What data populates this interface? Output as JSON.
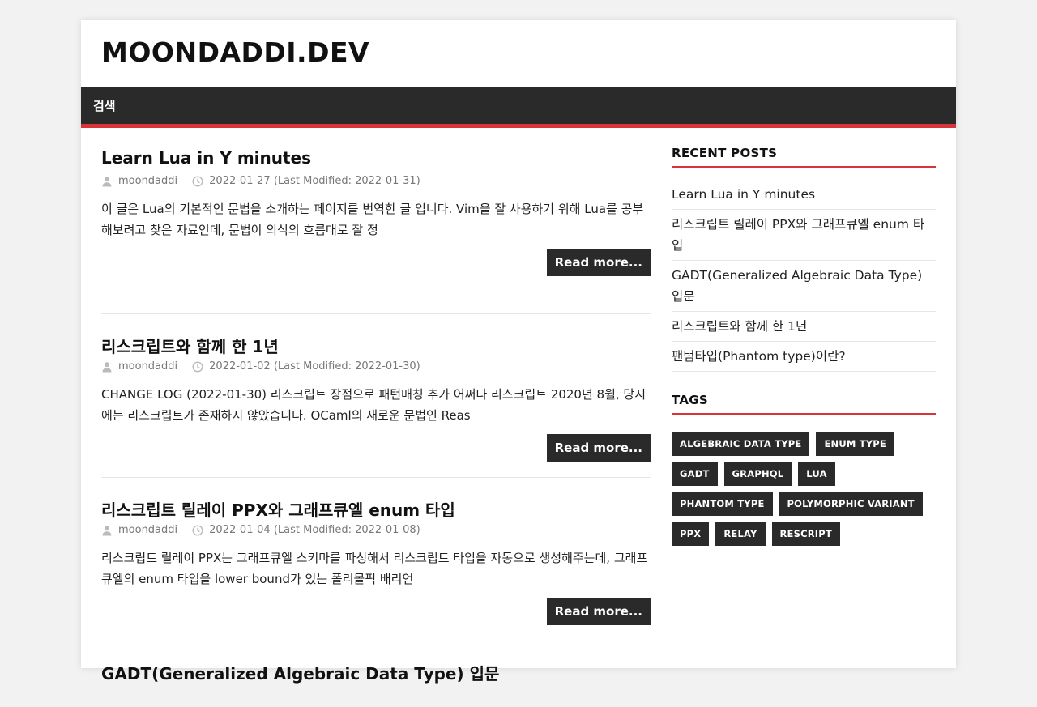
{
  "site": {
    "title": "MOONDADDI.DEV"
  },
  "nav": {
    "search_label": "검색"
  },
  "colors": {
    "accent": "#d8353a",
    "dark": "#2a2a2a"
  },
  "icons": {
    "author": "user-icon",
    "date": "clock-icon"
  },
  "posts": [
    {
      "title": "Learn Lua in Y minutes",
      "author": "moondaddi",
      "date": "2022-01-27 (Last Modified: 2022-01-31)",
      "excerpt": "이 글은 Lua의 기본적인 문법을 소개하는 페이지를 번역한 글 입니다. Vim을 잘 사용하기 위해 Lua를 공부해보려고 찾은 자료인데, 문법이 의식의 흐름대로 잘 정",
      "read_more": "Read more..."
    },
    {
      "title": "리스크립트와 함께 한 1년",
      "author": "moondaddi",
      "date": "2022-01-02 (Last Modified: 2022-01-30)",
      "excerpt": "CHANGE LOG (2022-01-30) 리스크립트 장점으로 패턴매칭 추가 어쩌다 리스크립트 2020년 8월, 당시에는 리스크립트가 존재하지 않았습니다. OCaml의 새로운 문법인 Reas",
      "read_more": "Read more..."
    },
    {
      "title": "리스크립트 릴레이 PPX와 그래프큐엘 enum 타입",
      "author": "moondaddi",
      "date": "2022-01-04 (Last Modified: 2022-01-08)",
      "excerpt": "리스크립트 릴레이 PPX는 그래프큐엘 스키마를 파싱해서 리스크립트 타입을 자동으로 생성해주는데, 그래프큐엘의 enum 타입을 lower bound가 있는 폴리몰픽 배리언",
      "read_more": "Read more..."
    },
    {
      "title": "GADT(Generalized Algebraic Data Type) 입문"
    }
  ],
  "sidebar": {
    "recent_title": "RECENT POSTS",
    "recent": [
      "Learn Lua in Y minutes",
      "리스크립트 릴레이 PPX와 그래프큐엘 enum 타입",
      "GADT(Generalized Algebraic Data Type) 입문",
      "리스크립트와 함께 한 1년",
      "팬텀타입(Phantom type)이란?"
    ],
    "tags_title": "TAGS",
    "tags": [
      "ALGEBRAIC DATA TYPE",
      "ENUM TYPE",
      "GADT",
      "GRAPHQL",
      "LUA",
      "PHANTOM TYPE",
      "POLYMORPHIC VARIANT",
      "PPX",
      "RELAY",
      "RESCRIPT"
    ]
  }
}
